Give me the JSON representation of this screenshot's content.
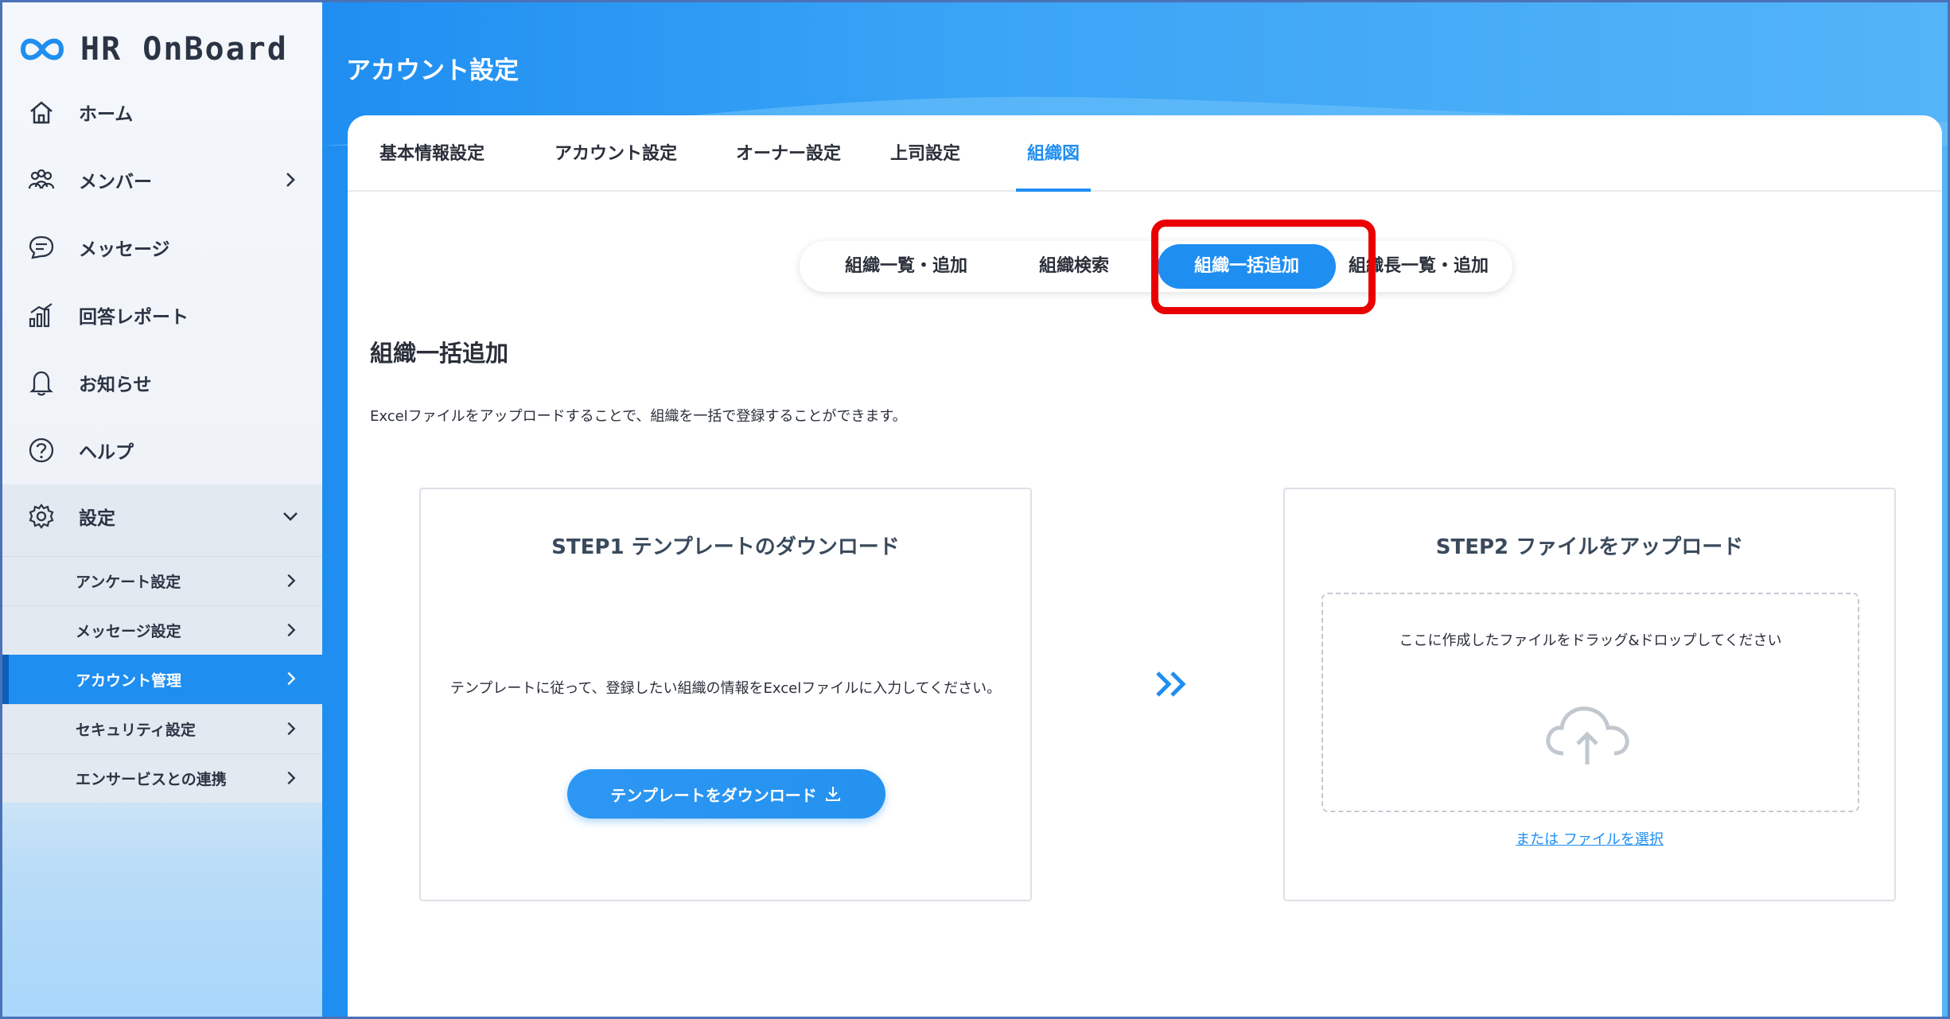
{
  "brand": {
    "name": "HR OnBoard",
    "icon": "infinity-heart-logo"
  },
  "sidebar": {
    "items": [
      {
        "label": "ホーム",
        "icon": "home-icon"
      },
      {
        "label": "メンバー",
        "icon": "members-icon"
      },
      {
        "label": "メッセージ",
        "icon": "message-icon"
      },
      {
        "label": "回答レポート",
        "icon": "report-icon"
      },
      {
        "label": "お知らせ",
        "icon": "bell-icon"
      },
      {
        "label": "ヘルプ",
        "icon": "help-icon"
      },
      {
        "label": "設定",
        "icon": "gear-icon"
      }
    ],
    "settings_sub": [
      {
        "label": "アンケート設定"
      },
      {
        "label": "メッセージ設定"
      },
      {
        "label": "アカウント管理"
      },
      {
        "label": "セキュリティ設定"
      },
      {
        "label": "エンサービスとの連携"
      }
    ]
  },
  "header": {
    "title": "アカウント設定"
  },
  "tabs": [
    {
      "label": "基本情報設定"
    },
    {
      "label": "アカウント設定"
    },
    {
      "label": "オーナー設定"
    },
    {
      "label": "上司設定"
    },
    {
      "label": "組織図"
    }
  ],
  "segments": [
    {
      "label": "組織一覧・追加"
    },
    {
      "label": "組織検索"
    },
    {
      "label": "組織一括追加"
    },
    {
      "label": "組織長一覧・追加"
    }
  ],
  "section": {
    "title": "組織一括追加",
    "description": "Excelファイルをアップロードすることで、組織を一括で登録することができます。"
  },
  "step1": {
    "title": "STEP1 テンプレートのダウンロード",
    "description": "テンプレートに従って、登録したい組織の情報をExcelファイルに入力してください。",
    "button": "テンプレートをダウンロード"
  },
  "step2": {
    "title": "STEP2 ファイルをアップロード",
    "dropzone": "ここに作成したファイルをドラッグ&ドロップしてください",
    "link": "または ファイルを選択"
  },
  "colors": {
    "accent": "#1f8ef1",
    "highlight": "#ea0000"
  }
}
